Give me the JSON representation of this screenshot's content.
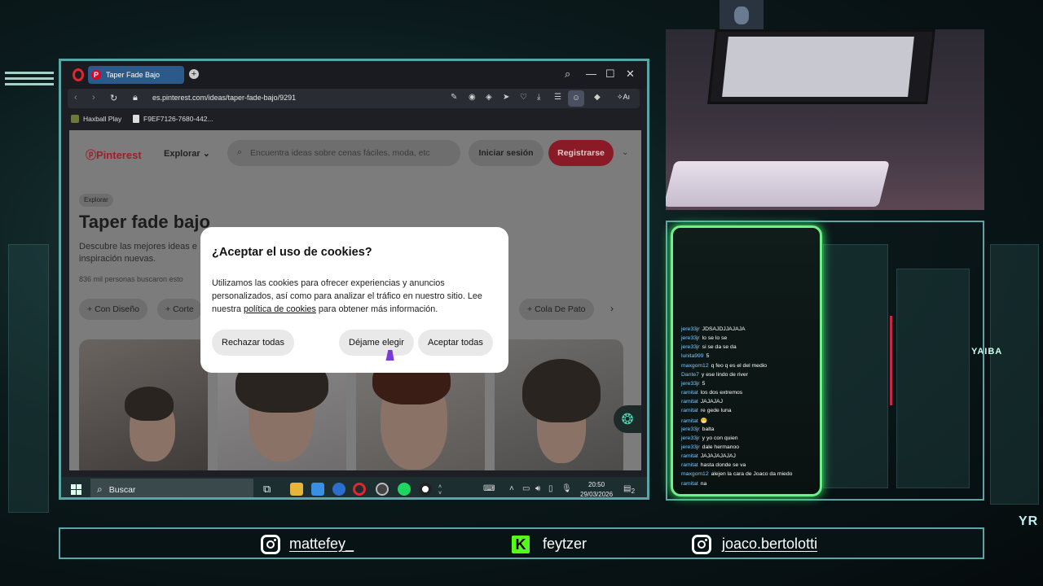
{
  "browser": {
    "tab_title": "Taper Fade Bajo",
    "url": "es.pinterest.com/ideas/taper-fade-bajo/9291",
    "ai_label": "Aı",
    "bookmarks": [
      "Haxball Play",
      "F9EF7126-7680-442..."
    ]
  },
  "pinterest": {
    "logo": "Pinterest",
    "explore": "Explorar",
    "search_placeholder": "Encuentra ideas sobre cenas fáciles, moda, etc",
    "login": "Iniciar sesión",
    "register": "Registrarse",
    "breadcrumb": "Explorar",
    "title": "Taper fade bajo",
    "description": "Descubre las mejores ideas e inspiración nuevas.",
    "searched": "836  mil personas buscaron esto",
    "chips": [
      "Con Diseño",
      "Corte",
      "Cola De Pato"
    ]
  },
  "cookie_modal": {
    "title": "¿Aceptar el uso de cookies?",
    "body_1": "Utilizamos las cookies para ofrecer experiencias y anuncios personalizados, así como para analizar el tráfico en nuestro sitio. Lee nuestra ",
    "link": "política de cookies",
    "body_2": " para obtener más información.",
    "reject": "Rechazar todas",
    "choose": "Déjame elegir",
    "accept": "Aceptar todas"
  },
  "taskbar": {
    "search": "Buscar",
    "time": "20:50",
    "date": "29/03/2026",
    "notifications": "2"
  },
  "chat": [
    {
      "user": "jere33jr",
      "msg": "JDSAJDJJAJAJA"
    },
    {
      "user": "jere33jr",
      "msg": "lo se lo se"
    },
    {
      "user": "jere33jr",
      "msg": "si se da se da"
    },
    {
      "user": "lunita999",
      "msg": "5"
    },
    {
      "user": "maxgom12",
      "msg": "q feo q es el del medio"
    },
    {
      "user": "Dante7",
      "msg": "y ese lindo de river"
    },
    {
      "user": "jere33jr",
      "msg": "5"
    },
    {
      "user": "ramitat",
      "msg": "los dos extremos"
    },
    {
      "user": "ramitat",
      "msg": "JAJAJAJ"
    },
    {
      "user": "ramitat",
      "msg": "re gede luna"
    },
    {
      "user": "ramitat",
      "msg": "😁"
    },
    {
      "user": "jere33jr",
      "msg": "balta"
    },
    {
      "user": "jere33jr",
      "msg": "y yo con quien"
    },
    {
      "user": "jere33jr",
      "msg": "dale hermanoo"
    },
    {
      "user": "ramitat",
      "msg": "JAJAJAJAJAJ"
    },
    {
      "user": "ramitat",
      "msg": "hasta donde se va"
    },
    {
      "user": "maxgom12",
      "msg": "alejen la cara de Joaco da miedo"
    },
    {
      "user": "ramitat",
      "msg": "na"
    }
  ],
  "signs": {
    "city": "YAIBA",
    "corner": "YR"
  },
  "social": {
    "ig_1": "mattefey_",
    "kick": "feytzer",
    "ig_2": "joaco.bertolotti"
  },
  "colors": {
    "frame": "#5aa6a6",
    "chat_glow": "#6ef08a",
    "pinterest_red": "#e60023",
    "kick_green": "#53fc18"
  }
}
